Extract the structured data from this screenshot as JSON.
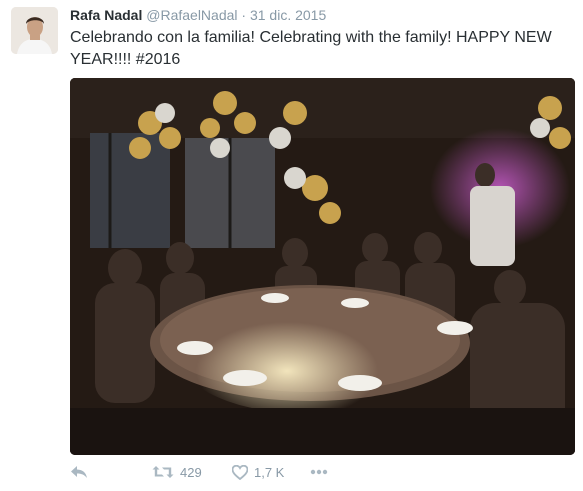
{
  "tweet": {
    "author_name": "Rafa Nadal",
    "handle": "@RafaelNadal",
    "separator": "·",
    "date": "31 dic. 2015",
    "text": "Celebrando con la familia! Celebrating with the family! HAPPY NEW YEAR!!!! #2016"
  },
  "actions": {
    "retweet_count": "429",
    "like_count": "1,7 K"
  },
  "icons": {
    "reply": "reply-icon",
    "retweet": "retweet-icon",
    "like": "heart-icon",
    "more": "more-icon"
  },
  "colors": {
    "text": "#292f33",
    "muted": "#8899a6"
  }
}
